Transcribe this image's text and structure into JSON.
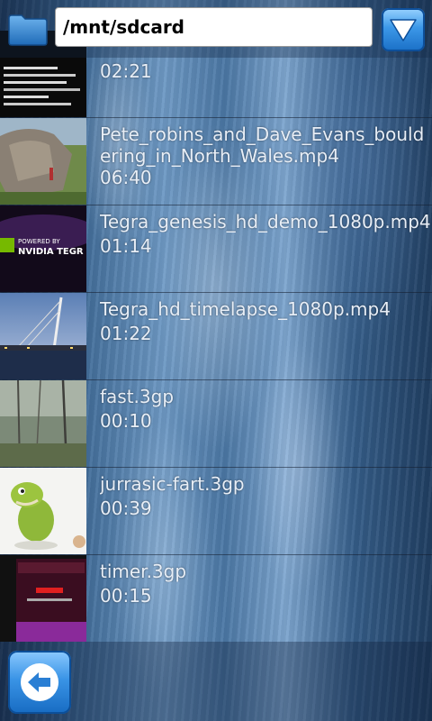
{
  "path_bar": {
    "value": "/mnt/sdcard",
    "folder_icon": "folder-icon",
    "menu_icon": "triangle-down-icon"
  },
  "files": [
    {
      "name": "",
      "duration": "02:21",
      "thumb": "terminal-thumbnail"
    },
    {
      "name": "Pete_robins_and_Dave_Evans_bouldering_in_North_Wales.mp4",
      "duration": "06:40",
      "thumb": "boulder-thumbnail"
    },
    {
      "name": "Tegra_genesis_hd_demo_1080p.mp4",
      "duration": "01:14",
      "thumb": "nvidia-tegra-thumbnail",
      "thumb_text": "NVIDIA TEGR"
    },
    {
      "name": "Tegra_hd_timelapse_1080p.mp4",
      "duration": "01:22",
      "thumb": "bridge-timelapse-thumbnail"
    },
    {
      "name": "fast.3gp",
      "duration": "00:10",
      "thumb": "forest-thumbnail"
    },
    {
      "name": "jurrasic-fart.3gp",
      "duration": "00:39",
      "thumb": "dinosaur-thumbnail"
    },
    {
      "name": "timer.3gp",
      "duration": "00:15",
      "thumb": "screen-thumbnail"
    }
  ],
  "bottom_bar": {
    "back_icon": "back-arrow-icon"
  },
  "colors": {
    "accent_blue": "#3c98e8",
    "text": "#e8eef6"
  }
}
